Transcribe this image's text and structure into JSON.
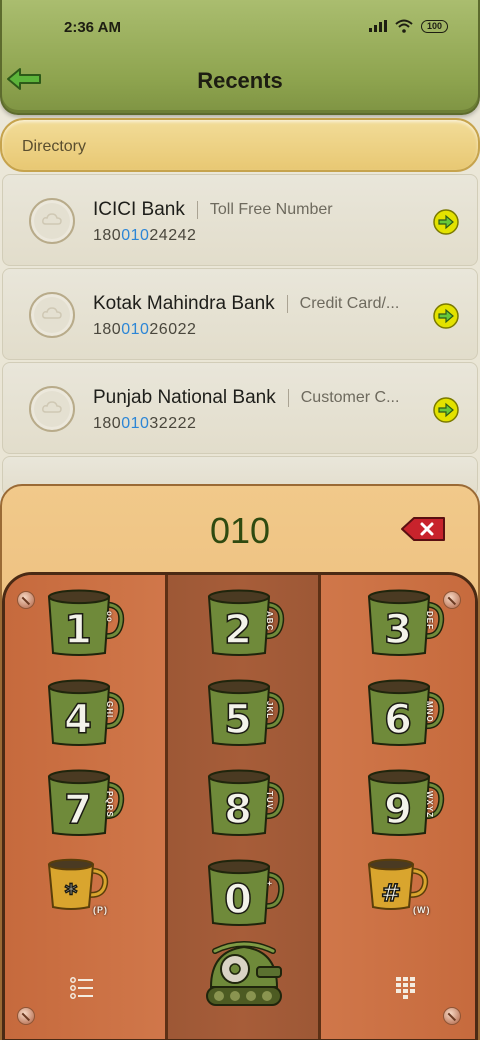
{
  "status_bar": {
    "time": "2:36 AM",
    "battery": "100"
  },
  "header": {
    "title": "Recents"
  },
  "directory": {
    "label": "Directory"
  },
  "contacts": [
    {
      "name": "ICICI Bank",
      "tag": "Toll Free Number",
      "number_prefix": "180",
      "number_match": "010",
      "number_suffix": "24242"
    },
    {
      "name": "Kotak Mahindra Bank",
      "tag": "Credit Card/...",
      "number_prefix": "180",
      "number_match": "010",
      "number_suffix": "26022"
    },
    {
      "name": "Punjab National Bank",
      "tag": "Customer C...",
      "number_prefix": "180",
      "number_match": "010",
      "number_suffix": "32222"
    }
  ],
  "dialer": {
    "typed": "010",
    "keys": [
      {
        "digit": "1",
        "sub": "oo"
      },
      {
        "digit": "2",
        "sub": "ABC"
      },
      {
        "digit": "3",
        "sub": "DEF"
      },
      {
        "digit": "4",
        "sub": "GHI"
      },
      {
        "digit": "5",
        "sub": "JKL"
      },
      {
        "digit": "6",
        "sub": "MNO"
      },
      {
        "digit": "7",
        "sub": "PQRS"
      },
      {
        "digit": "8",
        "sub": "TUV"
      },
      {
        "digit": "9",
        "sub": "WXYZ"
      },
      {
        "digit": "*",
        "sub": "(P)"
      },
      {
        "digit": "0",
        "sub": "+"
      },
      {
        "digit": "#",
        "sub": "(W)"
      }
    ]
  },
  "colors": {
    "header": "#8ea44f",
    "directory": "#e8c873",
    "highlight": "#2c86d6",
    "pad": "#c9693e",
    "mug": "#6f8a3a"
  }
}
